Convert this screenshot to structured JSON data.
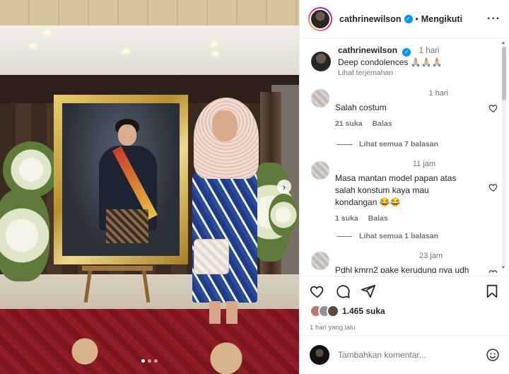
{
  "post": {
    "username": "cathrinewilson",
    "follow_separator": "•",
    "follow_label": "Mengikuti",
    "more_label": "···",
    "caption_text": "Deep condolences 🙏🏼🙏🏼🙏🏼",
    "caption_time": "1 hari",
    "translate_label": "Lihat terjemahan",
    "likes": "1.465 suka",
    "posted_ago": "1 hari yang lalu",
    "add_comment_placeholder": "Tambahkan komentar..."
  },
  "comments": [
    {
      "time": "1 hari",
      "text": "Salah costum",
      "likes": "21 suka",
      "reply_label": "Balas",
      "view_replies": "Lihat semua 7 balasan"
    },
    {
      "time": "11 jam",
      "text": "Masa mantan model papan atas salah konstum kaya mau kondangan 😂😂",
      "likes": "1 suka",
      "reply_label": "Balas",
      "view_replies": "Lihat semua 1 balasan"
    },
    {
      "time": "23 jam",
      "text": "Pdhl kmrn2 pake kerudung nya udh"
    }
  ],
  "carousel": {
    "next_label": "›",
    "slides": 3,
    "active_slide": 1
  },
  "colors": {
    "verified": "#0095f6",
    "muted": "#737373",
    "text": "#262626"
  }
}
